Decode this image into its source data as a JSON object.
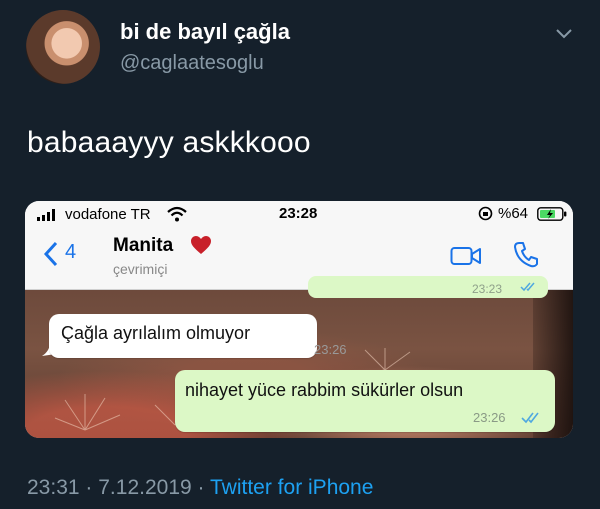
{
  "colors": {
    "background": "#15202b",
    "secondary_text": "#8899a6",
    "link": "#1da1f2",
    "outgoing_bubble": "#dcf8c6",
    "incoming_bubble": "#ffffff",
    "ios_blue": "#1a73e8",
    "heart": "#c8202a"
  },
  "tweet": {
    "display_name": "bi de bayıl çağla",
    "handle": "@caglaatesoglu",
    "text": "babaaayyy askkkooo",
    "time": "23:31",
    "separator": "·",
    "date": "7.12.2019",
    "client": "Twitter for iPhone"
  },
  "screenshot": {
    "status_bar": {
      "carrier": "vodafone TR",
      "time": "23:28",
      "battery_percent": "%64"
    },
    "header": {
      "back_count": "4",
      "contact_name": "Manita",
      "contact_status": "çevrimiçi",
      "icons": [
        "back-chevron-icon",
        "heart-icon",
        "video-call-icon",
        "phone-call-icon"
      ]
    },
    "messages": [
      {
        "direction": "outgoing",
        "text": "",
        "time": "23:23",
        "partial": true
      },
      {
        "direction": "incoming",
        "text": "Çağla ayrılalım olmuyor",
        "time": "23:26"
      },
      {
        "direction": "outgoing",
        "text": "nihayet yüce rabbim sükürler olsun",
        "time": "23:26",
        "read": true
      }
    ]
  }
}
